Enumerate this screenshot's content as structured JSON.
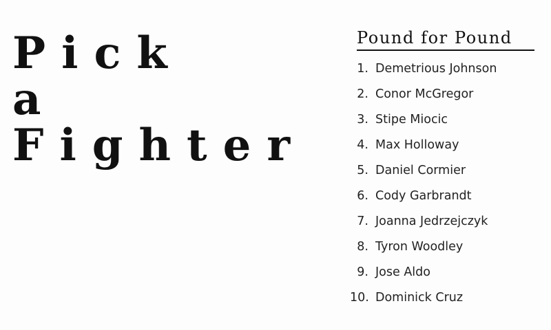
{
  "hero": {
    "lines": [
      "Pick",
      "a",
      "Fighter"
    ]
  },
  "rankings": {
    "title": "Pound for Pound",
    "items": [
      {
        "rank": "1.",
        "name": "Demetrious Johnson"
      },
      {
        "rank": "2.",
        "name": "Conor McGregor"
      },
      {
        "rank": "3.",
        "name": "Stipe Miocic"
      },
      {
        "rank": "4.",
        "name": "Max Holloway"
      },
      {
        "rank": "5.",
        "name": "Daniel Cormier"
      },
      {
        "rank": "6.",
        "name": "Cody Garbrandt"
      },
      {
        "rank": "7.",
        "name": "Joanna Jedrzejczyk"
      },
      {
        "rank": "8.",
        "name": "Tyron Woodley"
      },
      {
        "rank": "9.",
        "name": "Jose Aldo"
      },
      {
        "rank": "10.",
        "name": "Dominick Cruz"
      }
    ]
  }
}
